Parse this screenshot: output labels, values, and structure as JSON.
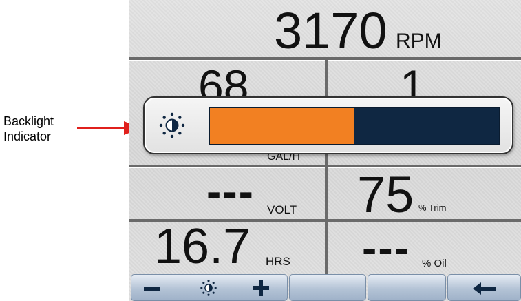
{
  "callout": {
    "line1": "Backlight",
    "line2": "Indicator",
    "arrow_color": "#e0201c"
  },
  "gauges": {
    "rpm": {
      "value": "3170",
      "unit": "RPM"
    },
    "top_left": {
      "value": "68"
    },
    "top_right": {
      "value": "1"
    },
    "fuel": {
      "unit": "GAL/H"
    },
    "volt": {
      "value": "---",
      "unit": "VOLT"
    },
    "trim": {
      "value": "75",
      "unit": "% Trim"
    },
    "hours": {
      "value": "16.7",
      "unit": "HRS"
    },
    "oil": {
      "value": "---",
      "unit": "% Oil"
    }
  },
  "backlight": {
    "icon": "brightness-icon",
    "level_fraction": 0.5,
    "fill_color": "#f28022",
    "track_color": "#0f2742"
  },
  "softkeys": [
    {
      "icon": "minus-icon"
    },
    {
      "icon": "brightness-icon"
    },
    {
      "icon": "plus-icon"
    },
    {
      "icon": "blank"
    },
    {
      "icon": "blank"
    },
    {
      "icon": "back-arrow-icon"
    }
  ],
  "colors": {
    "icon_navy": "#0f2742"
  }
}
